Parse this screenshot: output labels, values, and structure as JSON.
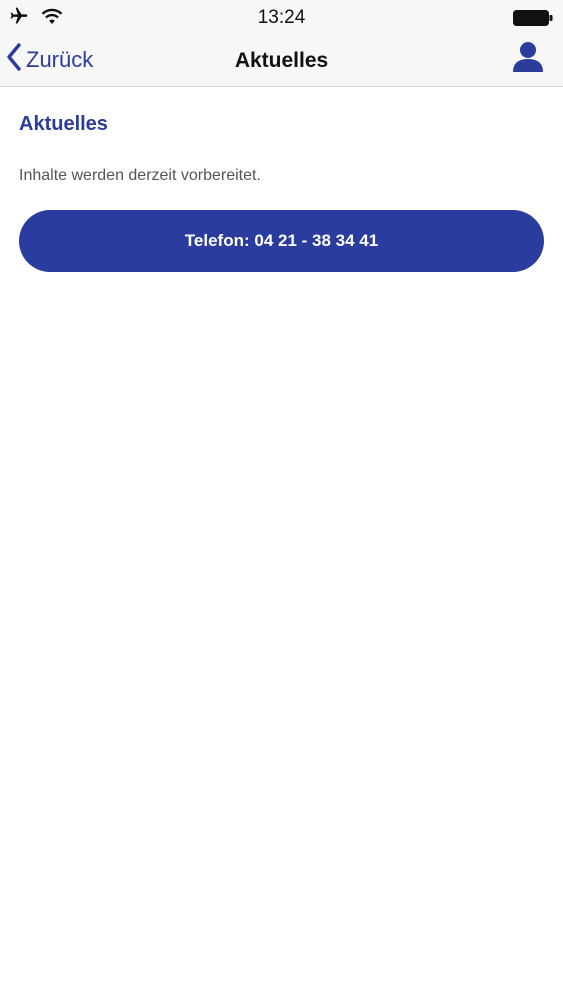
{
  "status_bar": {
    "time": "13:24",
    "icons": [
      "airplane-icon",
      "wifi-icon",
      "battery-icon"
    ]
  },
  "nav": {
    "back_label": "Zurück",
    "title": "Aktuelles",
    "back_icon": "chevron-left-icon",
    "user_icon": "user-icon"
  },
  "content": {
    "heading": "Aktuelles",
    "text": "Inhalte werden derzeit vorbereitet.",
    "phone_button_label": "Telefon: 04 21 - 38 34 41"
  },
  "colors": {
    "accent": "#2b3c9b",
    "button": "#2a3c9e",
    "bar_bg": "#f7f7f7",
    "text_gray": "#555555"
  }
}
